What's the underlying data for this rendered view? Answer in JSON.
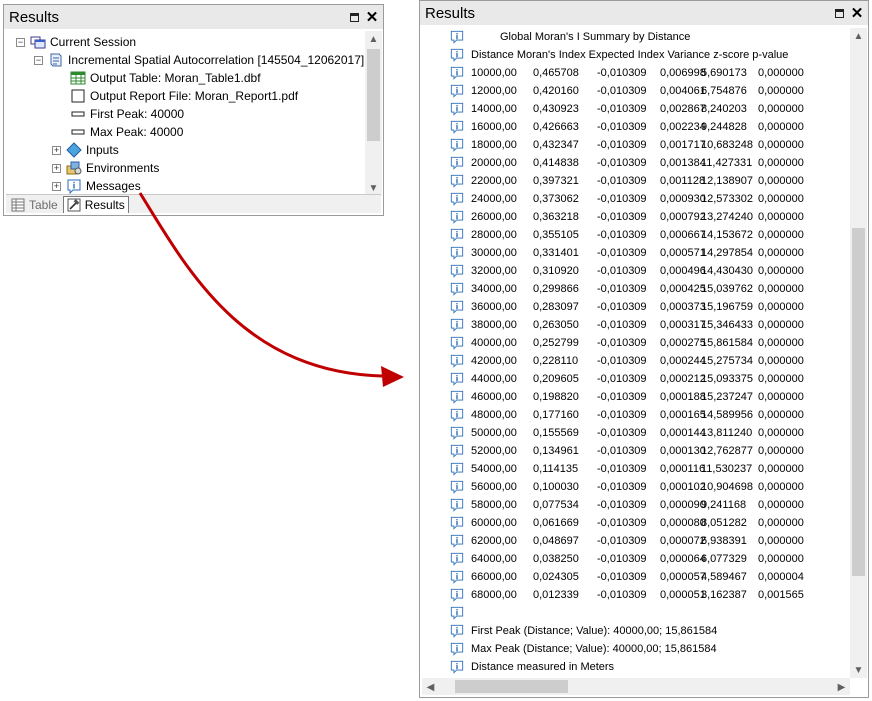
{
  "left_panel": {
    "title": "Results",
    "tree": {
      "session": "Current Session",
      "tool": "Incremental Spatial Autocorrelation [145504_12062017]",
      "output_table": "Output Table: Moran_Table1.dbf",
      "output_report": "Output Report File: Moran_Report1.pdf",
      "first_peak": "First Peak: 40000",
      "max_peak": "Max Peak: 40000",
      "inputs": "Inputs",
      "environments": "Environments",
      "messages": "Messages"
    },
    "tabs": {
      "table": "Table",
      "results": "Results"
    }
  },
  "right_panel": {
    "title": "Results",
    "summary_title": "Global Moran's I Summary by Distance",
    "header": "Distance Moran's Index Expected Index Variance  z-score  p-value",
    "rows": [
      {
        "distance": "10000,00",
        "moran": "0,465708",
        "expected": "-0,010309",
        "variance": "0,006998",
        "zscore": "5,690173",
        "pvalue": "0,000000"
      },
      {
        "distance": "12000,00",
        "moran": "0,420160",
        "expected": "-0,010309",
        "variance": "0,004061",
        "zscore": "6,754876",
        "pvalue": "0,000000"
      },
      {
        "distance": "14000,00",
        "moran": "0,430923",
        "expected": "-0,010309",
        "variance": "0,002867",
        "zscore": "8,240203",
        "pvalue": "0,000000"
      },
      {
        "distance": "16000,00",
        "moran": "0,426663",
        "expected": "-0,010309",
        "variance": "0,002234",
        "zscore": "9,244828",
        "pvalue": "0,000000"
      },
      {
        "distance": "18000,00",
        "moran": "0,432347",
        "expected": "-0,010309",
        "variance": "0,001717",
        "zscore": "10,683248",
        "pvalue": "0,000000"
      },
      {
        "distance": "20000,00",
        "moran": "0,414838",
        "expected": "-0,010309",
        "variance": "0,001384",
        "zscore": "11,427331",
        "pvalue": "0,000000"
      },
      {
        "distance": "22000,00",
        "moran": "0,397321",
        "expected": "-0,010309",
        "variance": "0,001128",
        "zscore": "12,138907",
        "pvalue": "0,000000"
      },
      {
        "distance": "24000,00",
        "moran": "0,373062",
        "expected": "-0,010309",
        "variance": "0,000930",
        "zscore": "12,573302",
        "pvalue": "0,000000"
      },
      {
        "distance": "26000,00",
        "moran": "0,363218",
        "expected": "-0,010309",
        "variance": "0,000792",
        "zscore": "13,274240",
        "pvalue": "0,000000"
      },
      {
        "distance": "28000,00",
        "moran": "0,355105",
        "expected": "-0,010309",
        "variance": "0,000667",
        "zscore": "14,153672",
        "pvalue": "0,000000"
      },
      {
        "distance": "30000,00",
        "moran": "0,331401",
        "expected": "-0,010309",
        "variance": "0,000571",
        "zscore": "14,297854",
        "pvalue": "0,000000"
      },
      {
        "distance": "32000,00",
        "moran": "0,310920",
        "expected": "-0,010309",
        "variance": "0,000496",
        "zscore": "14,430430",
        "pvalue": "0,000000"
      },
      {
        "distance": "34000,00",
        "moran": "0,299866",
        "expected": "-0,010309",
        "variance": "0,000425",
        "zscore": "15,039762",
        "pvalue": "0,000000"
      },
      {
        "distance": "36000,00",
        "moran": "0,283097",
        "expected": "-0,010309",
        "variance": "0,000373",
        "zscore": "15,196759",
        "pvalue": "0,000000"
      },
      {
        "distance": "38000,00",
        "moran": "0,263050",
        "expected": "-0,010309",
        "variance": "0,000317",
        "zscore": "15,346433",
        "pvalue": "0,000000"
      },
      {
        "distance": "40000,00",
        "moran": "0,252799",
        "expected": "-0,010309",
        "variance": "0,000275",
        "zscore": "15,861584",
        "pvalue": "0,000000"
      },
      {
        "distance": "42000,00",
        "moran": "0,228110",
        "expected": "-0,010309",
        "variance": "0,000244",
        "zscore": "15,275734",
        "pvalue": "0,000000"
      },
      {
        "distance": "44000,00",
        "moran": "0,209605",
        "expected": "-0,010309",
        "variance": "0,000212",
        "zscore": "15,093375",
        "pvalue": "0,000000"
      },
      {
        "distance": "46000,00",
        "moran": "0,198820",
        "expected": "-0,010309",
        "variance": "0,000188",
        "zscore": "15,237247",
        "pvalue": "0,000000"
      },
      {
        "distance": "48000,00",
        "moran": "0,177160",
        "expected": "-0,010309",
        "variance": "0,000165",
        "zscore": "14,589956",
        "pvalue": "0,000000"
      },
      {
        "distance": "50000,00",
        "moran": "0,155569",
        "expected": "-0,010309",
        "variance": "0,000144",
        "zscore": "13,811240",
        "pvalue": "0,000000"
      },
      {
        "distance": "52000,00",
        "moran": "0,134961",
        "expected": "-0,010309",
        "variance": "0,000130",
        "zscore": "12,762877",
        "pvalue": "0,000000"
      },
      {
        "distance": "54000,00",
        "moran": "0,114135",
        "expected": "-0,010309",
        "variance": "0,000116",
        "zscore": "11,530237",
        "pvalue": "0,000000"
      },
      {
        "distance": "56000,00",
        "moran": "0,100030",
        "expected": "-0,010309",
        "variance": "0,000102",
        "zscore": "10,904698",
        "pvalue": "0,000000"
      },
      {
        "distance": "58000,00",
        "moran": "0,077534",
        "expected": "-0,010309",
        "variance": "0,000090",
        "zscore": "9,241168",
        "pvalue": "0,000000"
      },
      {
        "distance": "60000,00",
        "moran": "0,061669",
        "expected": "-0,010309",
        "variance": "0,000080",
        "zscore": "8,051282",
        "pvalue": "0,000000"
      },
      {
        "distance": "62000,00",
        "moran": "0,048697",
        "expected": "-0,010309",
        "variance": "0,000072",
        "zscore": "6,938391",
        "pvalue": "0,000000"
      },
      {
        "distance": "64000,00",
        "moran": "0,038250",
        "expected": "-0,010309",
        "variance": "0,000064",
        "zscore": "6,077329",
        "pvalue": "0,000000"
      },
      {
        "distance": "66000,00",
        "moran": "0,024305",
        "expected": "-0,010309",
        "variance": "0,000057",
        "zscore": "4,589467",
        "pvalue": "0,000004"
      },
      {
        "distance": "68000,00",
        "moran": "0,012339",
        "expected": "-0,010309",
        "variance": "0,000051",
        "zscore": "3,162387",
        "pvalue": "0,001565"
      }
    ],
    "first_peak": "First Peak (Distance; Value): 40000,00; 15,861584",
    "max_peak": "Max Peak (Distance; Value): 40000,00; 15,861584",
    "units_note": "Distance measured in Meters"
  },
  "colors": {
    "arrow": "#c00000",
    "info_icon": "#2a6ebb",
    "titlebar": "#e9e9e9"
  }
}
